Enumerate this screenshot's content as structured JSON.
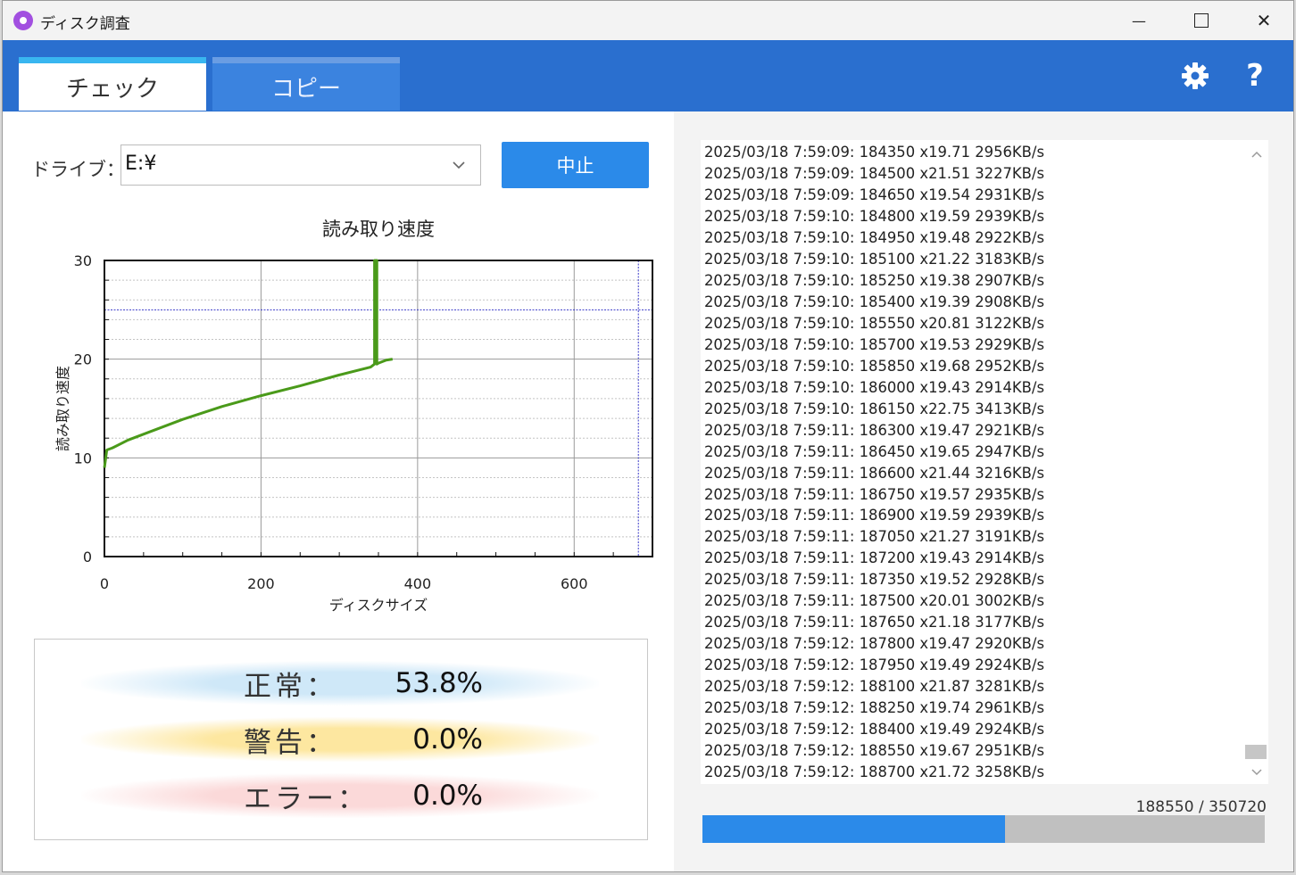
{
  "window": {
    "title": "ディスク調査",
    "controls": {
      "minimize": "—",
      "maximize": "☐",
      "close": "✕"
    }
  },
  "tabs": [
    {
      "label": "チェック",
      "active": true
    },
    {
      "label": "コピー",
      "active": false
    }
  ],
  "header_icons": [
    "gear-icon",
    "help-icon"
  ],
  "help_glyph": "?",
  "drive": {
    "label": "ドライブ：",
    "value": "E:¥"
  },
  "stop_button": "中止",
  "chart_data": {
    "type": "line",
    "title": "読み取り速度",
    "xlabel": "ディスクサイズ",
    "ylabel": "読み取り速度",
    "xlim": [
      0,
      700
    ],
    "ylim": [
      0,
      30
    ],
    "xticks": [
      "0",
      "200",
      "400",
      "600"
    ],
    "yticks": [
      "0",
      "10",
      "20",
      "30"
    ],
    "reference_lines": {
      "y": 25,
      "x": 682
    },
    "series": [
      {
        "color": "#4a9a1a",
        "x": [
          0,
          3,
          10,
          30,
          60,
          100,
          150,
          200,
          250,
          300,
          340,
          345,
          345,
          348,
          348,
          350,
          360,
          368
        ],
        "y": [
          9,
          10.8,
          11.0,
          11.8,
          12.7,
          13.9,
          15.2,
          16.3,
          17.3,
          18.4,
          19.2,
          19.5,
          30,
          30,
          19.5,
          19.6,
          19.9,
          20.0
        ]
      }
    ]
  },
  "stats": [
    {
      "label": "正常：",
      "value": "53.8%",
      "tint": "#cfe8f8"
    },
    {
      "label": "警告：",
      "value": "0.0%",
      "tint": "#fde7a0"
    },
    {
      "label": "エラー：",
      "value": "0.0%",
      "tint": "#fbd9d9"
    }
  ],
  "log": [
    "2025/03/18 7:59:09: 184350 x19.71 2956KB/s",
    "2025/03/18 7:59:09: 184500 x21.51 3227KB/s",
    "2025/03/18 7:59:09: 184650 x19.54 2931KB/s",
    "2025/03/18 7:59:10: 184800 x19.59 2939KB/s",
    "2025/03/18 7:59:10: 184950 x19.48 2922KB/s",
    "2025/03/18 7:59:10: 185100 x21.22 3183KB/s",
    "2025/03/18 7:59:10: 185250 x19.38 2907KB/s",
    "2025/03/18 7:59:10: 185400 x19.39 2908KB/s",
    "2025/03/18 7:59:10: 185550 x20.81 3122KB/s",
    "2025/03/18 7:59:10: 185700 x19.53 2929KB/s",
    "2025/03/18 7:59:10: 185850 x19.68 2952KB/s",
    "2025/03/18 7:59:10: 186000 x19.43 2914KB/s",
    "2025/03/18 7:59:10: 186150 x22.75 3413KB/s",
    "2025/03/18 7:59:11: 186300 x19.47 2921KB/s",
    "2025/03/18 7:59:11: 186450 x19.65 2947KB/s",
    "2025/03/18 7:59:11: 186600 x21.44 3216KB/s",
    "2025/03/18 7:59:11: 186750 x19.57 2935KB/s",
    "2025/03/18 7:59:11: 186900 x19.59 2939KB/s",
    "2025/03/18 7:59:11: 187050 x21.27 3191KB/s",
    "2025/03/18 7:59:11: 187200 x19.43 2914KB/s",
    "2025/03/18 7:59:11: 187350 x19.52 2928KB/s",
    "2025/03/18 7:59:11: 187500 x20.01 3002KB/s",
    "2025/03/18 7:59:11: 187650 x21.18 3177KB/s",
    "2025/03/18 7:59:12: 187800 x19.47 2920KB/s",
    "2025/03/18 7:59:12: 187950 x19.49 2924KB/s",
    "2025/03/18 7:59:12: 188100 x21.87 3281KB/s",
    "2025/03/18 7:59:12: 188250 x19.74 2961KB/s",
    "2025/03/18 7:59:12: 188400 x19.49 2924KB/s",
    "2025/03/18 7:59:12: 188550 x19.67 2951KB/s",
    "2025/03/18 7:59:12: 188700 x21.72 3258KB/s"
  ],
  "progress": {
    "text": "188550 / 350720",
    "current": 188550,
    "total": 350720,
    "color": "#2b8ae9"
  },
  "colors": {
    "header": "#2a6fcf",
    "accent": "#2b8ae9",
    "line": "#4a9a1a",
    "ref_line": "#3a3ac8"
  }
}
